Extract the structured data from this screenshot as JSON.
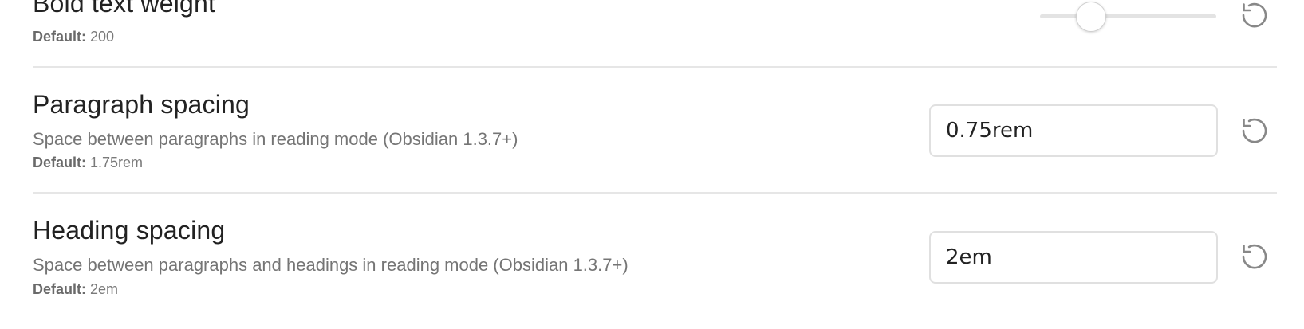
{
  "settings": {
    "bold_weight": {
      "title": "Bold text weight",
      "default_label": "Default:",
      "default_value": "200",
      "slider_fraction": 0.29
    },
    "paragraph_spacing": {
      "title": "Paragraph spacing",
      "description": "Space between paragraphs in reading mode (Obsidian 1.3.7+)",
      "default_label": "Default:",
      "default_value": "1.75rem",
      "value": "0.75rem"
    },
    "heading_spacing": {
      "title": "Heading spacing",
      "description": "Space between paragraphs and headings in reading mode (Obsidian 1.3.7+)",
      "default_label": "Default:",
      "default_value": "2em",
      "value": "2em"
    }
  },
  "icons": {
    "reset": "reset-icon"
  },
  "colors": {
    "title": "#222222",
    "description": "#757575",
    "divider": "#e6e6e6",
    "icon": "#888888"
  }
}
